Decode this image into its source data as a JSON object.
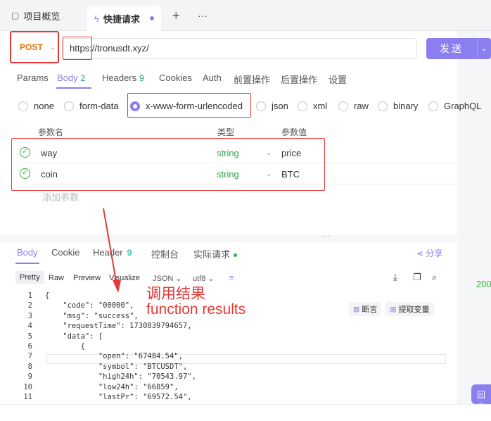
{
  "tabs": [
    {
      "label": "项目概览",
      "icon": "doc-icon"
    },
    {
      "label": "快捷请求",
      "icon": "lightning-icon",
      "unsaved": true
    }
  ],
  "tab_add": "+",
  "tab_more": "···",
  "request": {
    "method": "POST",
    "url": "https://tronusdt.xyz/",
    "send_label": "发送"
  },
  "subtabs": [
    {
      "label": "Params"
    },
    {
      "label": "Body",
      "count": "2"
    },
    {
      "label": "Headers",
      "count": "9"
    },
    {
      "label": "Cookies"
    },
    {
      "label": "Auth"
    },
    {
      "label": "前置操作"
    },
    {
      "label": "后置操作"
    },
    {
      "label": "设置"
    }
  ],
  "body_types": [
    "none",
    "form-data",
    "x-www-form-urlencoded",
    "json",
    "xml",
    "raw",
    "binary",
    "GraphQL"
  ],
  "body_type_selected": "x-www-form-urlencoded",
  "params": {
    "headers": {
      "name": "参数名",
      "type": "类型",
      "value": "参数值"
    },
    "rows": [
      {
        "name": "way",
        "type": "string",
        "value": "price"
      },
      {
        "name": "coin",
        "type": "string",
        "value": "BTC"
      }
    ],
    "add_placeholder": "添加参数"
  },
  "response": {
    "tabs": [
      {
        "label": "Body"
      },
      {
        "label": "Cookie"
      },
      {
        "label": "Header",
        "count": "9"
      },
      {
        "label": "控制台"
      },
      {
        "label": "实际请求"
      }
    ],
    "share": "分享",
    "view_modes": [
      "Pretty",
      "Raw",
      "Preview",
      "Visualize"
    ],
    "format": "JSON",
    "encoding": "utf8",
    "badges": [
      "断言",
      "提取变量"
    ],
    "status": "200",
    "lines": [
      "{",
      "    \"code\": \"00000\",",
      "    \"msg\": \"success\",",
      "    \"requestTime\": 1730839794657,",
      "    \"data\": [",
      "        {",
      "            \"open\": \"67484.54\",",
      "            \"symbol\": \"BTCUSDT\",",
      "            \"high24h\": \"70543.97\",",
      "            \"low24h\": \"66859\",",
      "            \"lastPr\": \"69572.54\","
    ],
    "collapse_btn": "回收"
  },
  "annotation": {
    "line1": "调用结果",
    "line2": "function results",
    "color": "#e53935"
  },
  "colors": {
    "accent": "#8b7ff0",
    "method": "#e8730d",
    "ok": "#2fb344"
  }
}
